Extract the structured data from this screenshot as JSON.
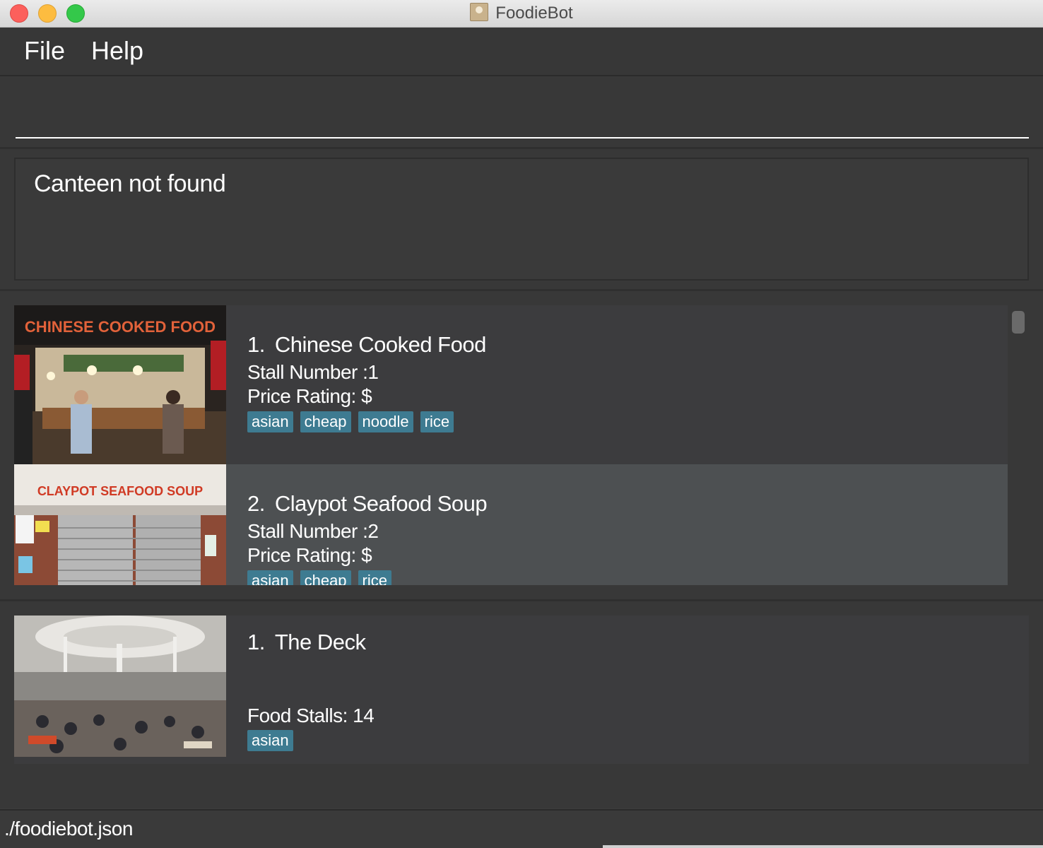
{
  "window": {
    "title": "FoodieBot"
  },
  "menu": {
    "file": "File",
    "help": "Help"
  },
  "command": {
    "value": "",
    "placeholder": ""
  },
  "result": {
    "message": "Canteen not found"
  },
  "stalls": [
    {
      "index": "1.",
      "name": "Chinese Cooked Food",
      "stall_number": "Stall Number :1",
      "price_rating": "Price Rating: $",
      "tags": [
        "asian",
        "cheap",
        "noodle",
        "rice"
      ],
      "sign": "CHINESE COOKED FOOD"
    },
    {
      "index": "2.",
      "name": "Claypot Seafood Soup",
      "stall_number": "Stall Number :2",
      "price_rating": "Price Rating: $",
      "tags": [
        "asian",
        "cheap",
        "rice"
      ],
      "sign": "CLAYPOT SEAFOOD SOUP"
    }
  ],
  "canteens": [
    {
      "index": "1.",
      "name": "The Deck",
      "food_stalls": "Food Stalls: 14",
      "tags": [
        "asian"
      ]
    }
  ],
  "status": {
    "file_path": "./foodiebot.json"
  },
  "colors": {
    "tag": "#3e7b91",
    "selected_card": "#4d5052",
    "background": "#3c3c3c"
  }
}
